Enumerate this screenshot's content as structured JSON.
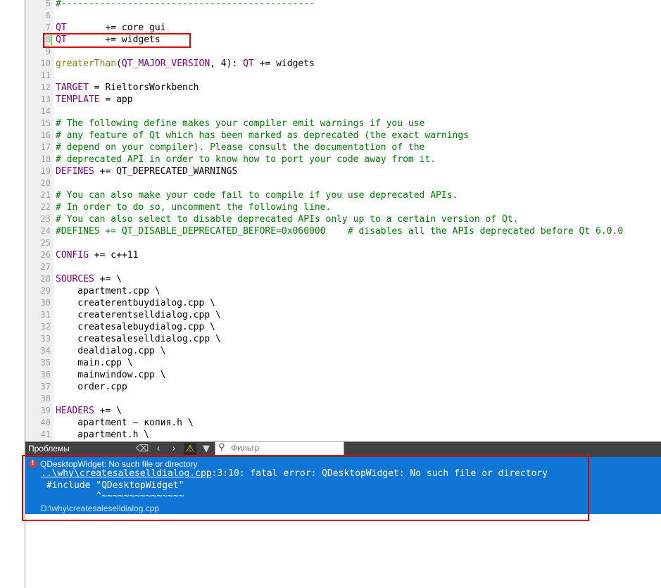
{
  "editor": {
    "lines": [
      {
        "n": "5",
        "parts": [
          {
            "t": "#----------------------------------------------",
            "c": "cm"
          }
        ]
      },
      {
        "n": "6",
        "parts": []
      },
      {
        "n": "7",
        "parts": [
          {
            "t": "QT",
            "c": "kw"
          },
          {
            "t": "       += core gui",
            "c": ""
          }
        ]
      },
      {
        "n": "8",
        "parts": [
          {
            "t": "QT",
            "c": "kw"
          },
          {
            "t": "       += widgets",
            "c": ""
          }
        ]
      },
      {
        "n": "9",
        "parts": []
      },
      {
        "n": "10",
        "parts": [
          {
            "t": "greaterThan",
            "c": "fn"
          },
          {
            "t": "(",
            "c": ""
          },
          {
            "t": "QT_MAJOR_VERSION",
            "c": "kw"
          },
          {
            "t": ", 4): ",
            "c": ""
          },
          {
            "t": "QT",
            "c": "kw"
          },
          {
            "t": " += widgets",
            "c": ""
          }
        ]
      },
      {
        "n": "11",
        "parts": []
      },
      {
        "n": "12",
        "parts": [
          {
            "t": "TARGET",
            "c": "kw"
          },
          {
            "t": " = RieltorsWorkbench",
            "c": ""
          }
        ]
      },
      {
        "n": "13",
        "parts": [
          {
            "t": "TEMPLATE",
            "c": "kw"
          },
          {
            "t": " = app",
            "c": ""
          }
        ]
      },
      {
        "n": "14",
        "parts": []
      },
      {
        "n": "15",
        "parts": [
          {
            "t": "# The following define makes your compiler emit warnings if you use",
            "c": "cm"
          }
        ]
      },
      {
        "n": "16",
        "parts": [
          {
            "t": "# any feature of Qt which has been marked as deprecated (the exact warnings",
            "c": "cm"
          }
        ]
      },
      {
        "n": "17",
        "parts": [
          {
            "t": "# depend on your compiler). Please consult the documentation of the",
            "c": "cm"
          }
        ]
      },
      {
        "n": "18",
        "parts": [
          {
            "t": "# deprecated API in order to know how to port your code away from it.",
            "c": "cm"
          }
        ]
      },
      {
        "n": "19",
        "parts": [
          {
            "t": "DEFINES",
            "c": "kw"
          },
          {
            "t": " += QT_DEPRECATED_WARNINGS",
            "c": ""
          }
        ]
      },
      {
        "n": "20",
        "parts": []
      },
      {
        "n": "21",
        "parts": [
          {
            "t": "# You can also make your code fail to compile if you use deprecated APIs.",
            "c": "cm"
          }
        ]
      },
      {
        "n": "22",
        "parts": [
          {
            "t": "# In order to do so, uncomment the following line.",
            "c": "cm"
          }
        ]
      },
      {
        "n": "23",
        "parts": [
          {
            "t": "# You can also select to disable deprecated APIs only up to a certain version of Qt.",
            "c": "cm"
          }
        ]
      },
      {
        "n": "24",
        "parts": [
          {
            "t": "#DEFINES += QT_DISABLE_DEPRECATED_BEFORE=0x060000    # disables all the APIs deprecated before Qt 6.0.0",
            "c": "cm"
          }
        ]
      },
      {
        "n": "25",
        "parts": []
      },
      {
        "n": "26",
        "parts": [
          {
            "t": "CONFIG",
            "c": "kw"
          },
          {
            "t": " += c++11",
            "c": ""
          }
        ]
      },
      {
        "n": "27",
        "parts": []
      },
      {
        "n": "28",
        "parts": [
          {
            "t": "SOURCES",
            "c": "kw"
          },
          {
            "t": " += \\",
            "c": ""
          }
        ]
      },
      {
        "n": "29",
        "parts": [
          {
            "t": "    apartment.cpp \\",
            "c": ""
          }
        ]
      },
      {
        "n": "30",
        "parts": [
          {
            "t": "    createrentbuydialog.cpp \\",
            "c": ""
          }
        ]
      },
      {
        "n": "31",
        "parts": [
          {
            "t": "    createrentselldialog.cpp \\",
            "c": ""
          }
        ]
      },
      {
        "n": "32",
        "parts": [
          {
            "t": "    createsalebuydialog.cpp \\",
            "c": ""
          }
        ]
      },
      {
        "n": "33",
        "parts": [
          {
            "t": "    createsaleselldialog.cpp \\",
            "c": ""
          }
        ]
      },
      {
        "n": "34",
        "parts": [
          {
            "t": "    dealdialog.cpp \\",
            "c": ""
          }
        ]
      },
      {
        "n": "35",
        "parts": [
          {
            "t": "    main.cpp \\",
            "c": ""
          }
        ]
      },
      {
        "n": "36",
        "parts": [
          {
            "t": "    mainwindow.cpp \\",
            "c": ""
          }
        ]
      },
      {
        "n": "37",
        "parts": [
          {
            "t": "    order.cpp",
            "c": ""
          }
        ]
      },
      {
        "n": "38",
        "parts": []
      },
      {
        "n": "39",
        "parts": [
          {
            "t": "HEADERS",
            "c": "kw"
          },
          {
            "t": " += \\",
            "c": ""
          }
        ]
      },
      {
        "n": "40",
        "parts": [
          {
            "t": "    apartment — копия.h \\",
            "c": ""
          }
        ]
      },
      {
        "n": "41",
        "parts": [
          {
            "t": "    apartment.h \\",
            "c": ""
          }
        ]
      }
    ]
  },
  "issues": {
    "title": "Проблемы",
    "filter_placeholder": "Фильтр",
    "toolbar_icons": [
      "clear-icon",
      "prev-arrow-icon",
      "next-arrow-icon",
      "warning-filter-icon",
      "filter-icon"
    ],
    "error": {
      "title": "QDesktopWidget: No such file or directory",
      "file_link": "..\\why\\createsaleselldialog.cpp",
      "message": ":3:10: fatal error: QDesktopWidget: No such file or directory",
      "include_line": " #include \"QDesktopWidget\"",
      "caret_line": "          ^~~~~~~~~~~~~~~~",
      "path": "D:\\why\\createsaleselldialog.cpp"
    }
  },
  "colors": {
    "accent_selection": "#0f76d6",
    "annotation": "#e00000",
    "keyword": "#800080",
    "comment": "#008000"
  }
}
